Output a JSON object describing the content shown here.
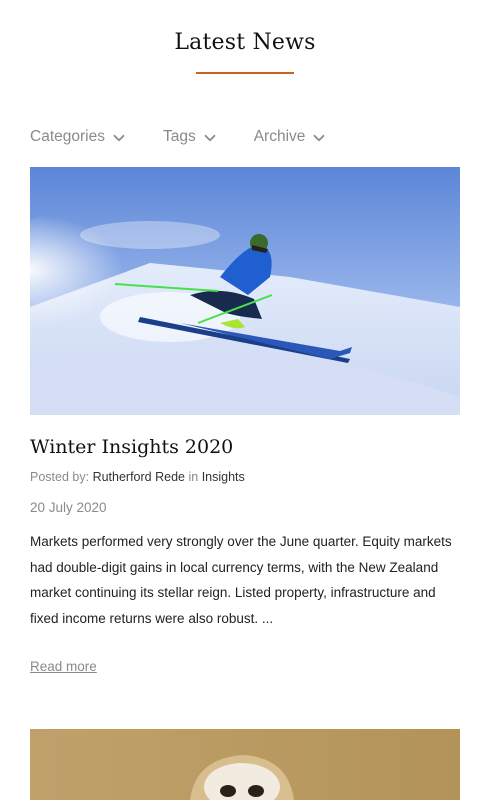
{
  "header": {
    "title": "Latest News"
  },
  "filters": [
    {
      "label": "Categories",
      "icon": "chevron-down-icon"
    },
    {
      "label": "Tags",
      "icon": "chevron-down-icon"
    },
    {
      "label": "Archive",
      "icon": "chevron-down-icon"
    }
  ],
  "posts": [
    {
      "image": "skier-photo",
      "title": "Winter Insights 2020",
      "posted_by_label": "Posted by:",
      "author": "Rutherford Rede",
      "in_label": "in",
      "category": "Insights",
      "date": "20 July 2020",
      "excerpt": "Markets performed very strongly over the June quarter. Equity markets had double-digit gains in local currency terms, with the New Zealand market continuing its stellar reign. Listed property, infrastructure and fixed income returns were also robust. ...",
      "read_more": "Read more"
    },
    {
      "image": "owl-photo"
    }
  ],
  "colors": {
    "accent": "#c8641f",
    "muted": "#8a8a8a",
    "text": "#222222"
  }
}
